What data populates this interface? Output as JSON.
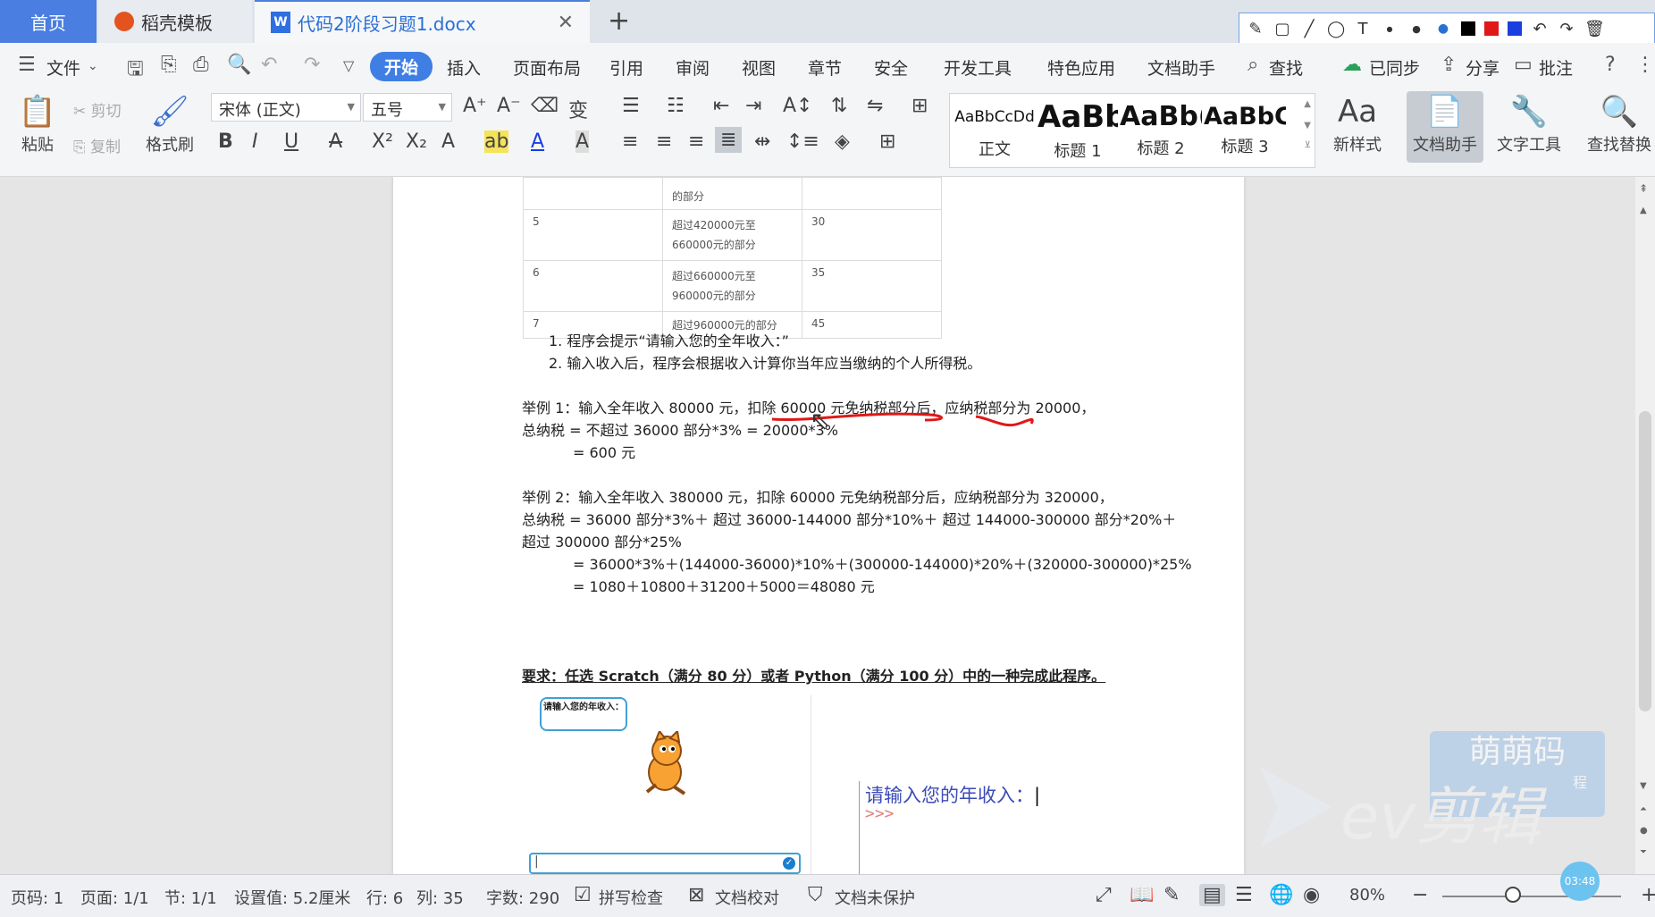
{
  "tabs": {
    "home": "首页",
    "templates": "稻壳模板",
    "document": "代码2阶段习题1.docx",
    "add": "+"
  },
  "menu": {
    "file": "文件",
    "items": [
      "开始",
      "插入",
      "页面布局",
      "引用",
      "审阅",
      "视图",
      "章节",
      "安全",
      "开发工具",
      "特色应用",
      "文档助手"
    ],
    "search": "查找",
    "synced": "已同步",
    "share": "分享",
    "annotate": "批注"
  },
  "ribbon": {
    "paste": "粘贴",
    "cut": "剪切",
    "copy": "复制",
    "format_painter": "格式刷",
    "font_name": "宋体 (正文)",
    "font_size": "五号",
    "styles": [
      {
        "preview": "AaBbCcDd",
        "label": "正文"
      },
      {
        "preview": "AaBb",
        "label": "标题 1"
      },
      {
        "preview": "AaBb(",
        "label": "标题 2"
      },
      {
        "preview": "AaBbC",
        "label": "标题 3"
      }
    ],
    "new_style": "新样式",
    "doc_assistant": "文档助手",
    "text_tools": "文字工具",
    "find_replace": "查找替换"
  },
  "document": {
    "table_rows": [
      {
        "level": "",
        "range": "的部分",
        "rate": ""
      },
      {
        "level": "5",
        "range": "超过420000元至660000元的部分",
        "rate": "30"
      },
      {
        "level": "6",
        "range": "超过660000元至960000元的部分",
        "rate": "35"
      },
      {
        "level": "7",
        "range": "超过960000元的部分",
        "rate": "45"
      }
    ],
    "list": [
      "1.  程序会提示“请输入您的全年收入：”",
      "2.  输入收入后，程序会根据收入计算你当年应当缴纳的个人所得税。"
    ],
    "ex1_line1": "举例 1：输入全年收入 80000 元，扣除 60000 元免纳税部分后，应纳税部分为 20000，",
    "ex1_line2": "总纳税  =  不超过 36000 部分*3% = 20000*3%",
    "ex1_line3": "= 600 元",
    "ex2_line1": "举例 2：输入全年收入 380000 元，扣除 60000 元免纳税部分后，应纳税部分为 320000，",
    "ex2_line2": "总纳税  = 36000 部分*3%＋  超过 36000-144000 部分*10%＋  超过 144000-300000 部分*20%＋",
    "ex2_line3": "超过 300000 部分*25%",
    "ex2_line4": "= 36000*3%＋(144000-36000)*10%＋(300000-144000)*20%＋(320000-300000)*25%",
    "ex2_line5": "= 1080＋10800＋31200＋5000＝48080 元",
    "requirement": "要求：任选 Scratch（满分 80 分）或者 Python（满分 100 分）中的一种完成此程序。",
    "scratch_bubble": "请输入您的年收入：",
    "python_prompt": "请输入您的年收入：",
    "python_caret": ">>>"
  },
  "watermark": {
    "brand": "萌萌码",
    "sub": "程",
    "ev": "ev剪辑"
  },
  "status": {
    "page_no": "页码: 1",
    "pages": "页面: 1/1",
    "section": "节: 1/1",
    "setting": "设置值: 5.2厘米",
    "row": "行: 6",
    "col": "列: 35",
    "words": "字数: 290",
    "spell": "拼写检查",
    "proof": "文档校对",
    "protect": "文档未保护",
    "zoom": "80%",
    "timer": "03:48"
  },
  "colors": {
    "accent": "#3f7fe4",
    "annotation_red": "#e01818"
  }
}
